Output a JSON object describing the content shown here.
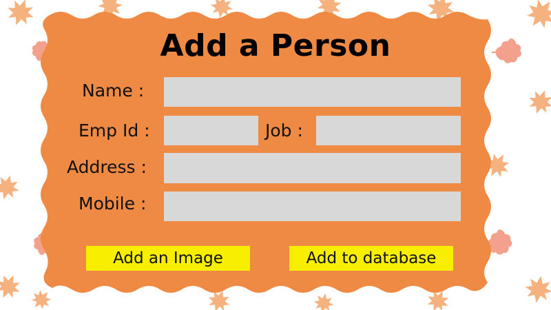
{
  "form": {
    "title": "Add a Person",
    "fields": {
      "name": {
        "label": "Name :",
        "value": ""
      },
      "emp_id": {
        "label": "Emp Id :",
        "value": ""
      },
      "job": {
        "label": "Job :",
        "value": ""
      },
      "address": {
        "label": "Address :",
        "value": ""
      },
      "mobile": {
        "label": "Mobile :",
        "value": ""
      }
    },
    "buttons": {
      "add_image": "Add an Image",
      "add_to_database": "Add to database"
    }
  },
  "colors": {
    "card": "#ee8a44",
    "field": "#d8d8d8",
    "button": "#f7ee00",
    "leaf_orange": "#f5b27f",
    "leaf_pink": "#f3a08d"
  }
}
